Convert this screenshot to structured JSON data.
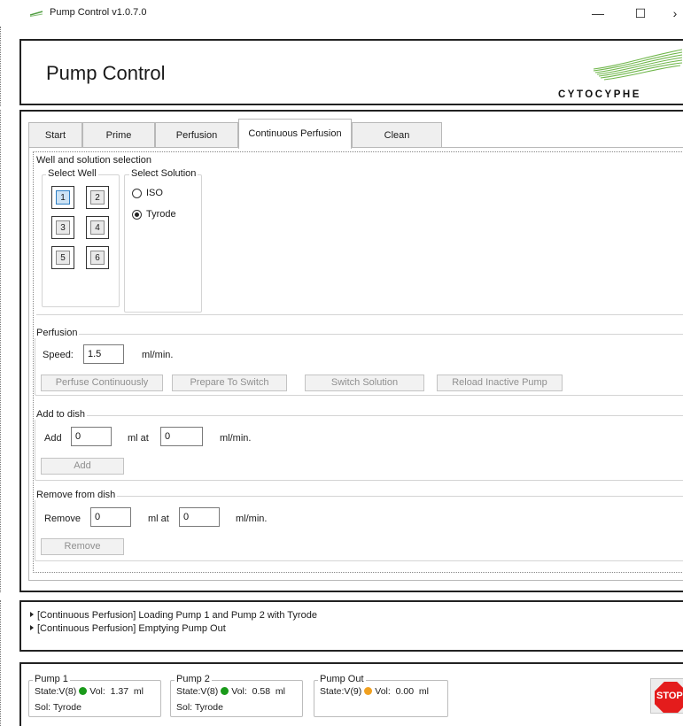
{
  "window": {
    "title": "Pump Control v1.0.7.0",
    "minimize_glyph": "—",
    "maximize_glyph": "☐",
    "close_glyph": "›"
  },
  "header": {
    "title": "Pump Control",
    "logo_text": "CYTOCYPHE"
  },
  "tabs": [
    {
      "label": "Start"
    },
    {
      "label": "Prime"
    },
    {
      "label": "Perfusion"
    },
    {
      "label": "Continuous Perfusion",
      "active": true
    },
    {
      "label": "Clean"
    }
  ],
  "well_solution": {
    "title": "Well and solution selection",
    "select_well_label": "Select Well",
    "wells": [
      "1",
      "2",
      "3",
      "4",
      "5",
      "6"
    ],
    "selected_well": "1",
    "select_solution_label": "Select Solution",
    "solutions": [
      {
        "label": "ISO",
        "selected": false
      },
      {
        "label": "Tyrode",
        "selected": true
      }
    ]
  },
  "perfusion": {
    "title": "Perfusion",
    "speed_label": "Speed:",
    "speed_value": "1.5",
    "speed_unit": "ml/min.",
    "buttons": [
      "Perfuse Continuously",
      "Prepare To Switch",
      "Switch Solution",
      "Reload Inactive Pump"
    ]
  },
  "add_to_dish": {
    "title": "Add to dish",
    "add_label": "Add",
    "volume_value": "0",
    "ml_at": "ml at",
    "rate_value": "0",
    "rate_unit": "ml/min.",
    "button": "Add"
  },
  "remove_from_dish": {
    "title": "Remove from dish",
    "remove_label": "Remove",
    "volume_value": "0",
    "ml_at": "ml at",
    "rate_value": "0",
    "rate_unit": "ml/min.",
    "button": "Remove"
  },
  "log": [
    "[Continuous Perfusion] Loading Pump 1 and Pump 2 with Tyrode",
    "[Continuous Perfusion] Emptying Pump Out"
  ],
  "pumps": [
    {
      "name": "Pump 1",
      "state_label": "State:V(8)",
      "status_color": "#1a9a1a",
      "vol_label": "Vol:",
      "vol": "1.37",
      "unit": "ml",
      "sol": "Sol: Tyrode"
    },
    {
      "name": "Pump 2",
      "state_label": "State:V(8)",
      "status_color": "#1a9a1a",
      "vol_label": "Vol:",
      "vol": "0.58",
      "unit": "ml",
      "sol": "Sol: Tyrode"
    },
    {
      "name": "Pump Out",
      "state_label": "State:V(9)",
      "status_color": "#f0a020",
      "vol_label": "Vol:",
      "vol": "0.00",
      "unit": "ml",
      "sol": ""
    }
  ],
  "stop_button": {
    "label": "STOP"
  }
}
